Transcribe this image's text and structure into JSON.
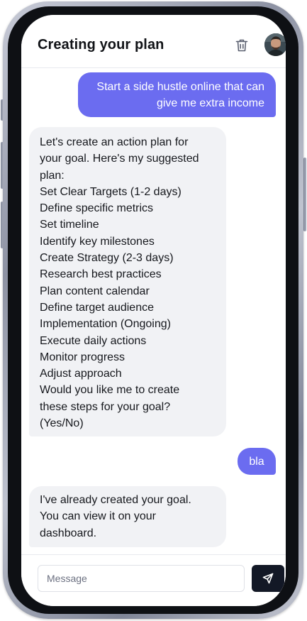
{
  "header": {
    "title": "Creating your plan",
    "delete_icon": "trash-icon",
    "avatar_icon": "user-avatar"
  },
  "messages": [
    {
      "role": "user",
      "lines": [
        "Start a side hustle online that can",
        "give me extra income"
      ]
    },
    {
      "role": "assistant",
      "lines": [
        "Let's create an action plan for",
        "your goal. Here's my suggested",
        "plan:",
        "Set Clear Targets (1-2 days)",
        "Define specific metrics",
        "Set timeline",
        "Identify key milestones",
        "Create Strategy (2-3 days)",
        "Research best practices",
        "Plan content calendar",
        "Define target audience",
        "Implementation (Ongoing)",
        "Execute daily actions",
        "Monitor progress",
        "Adjust approach",
        "Would you like me to create",
        "these steps for your goal?",
        "(Yes/No)"
      ]
    },
    {
      "role": "user",
      "lines": [
        "bla"
      ]
    },
    {
      "role": "assistant",
      "lines": [
        "I've already created your goal.",
        "You can view it on your",
        "dashboard."
      ]
    }
  ],
  "composer": {
    "placeholder": "Message",
    "value": "",
    "send_icon": "send-icon"
  },
  "colors": {
    "user_bubble": "#6b6cf0",
    "assistant_bubble": "#f1f2f5",
    "send_button": "#131826"
  }
}
